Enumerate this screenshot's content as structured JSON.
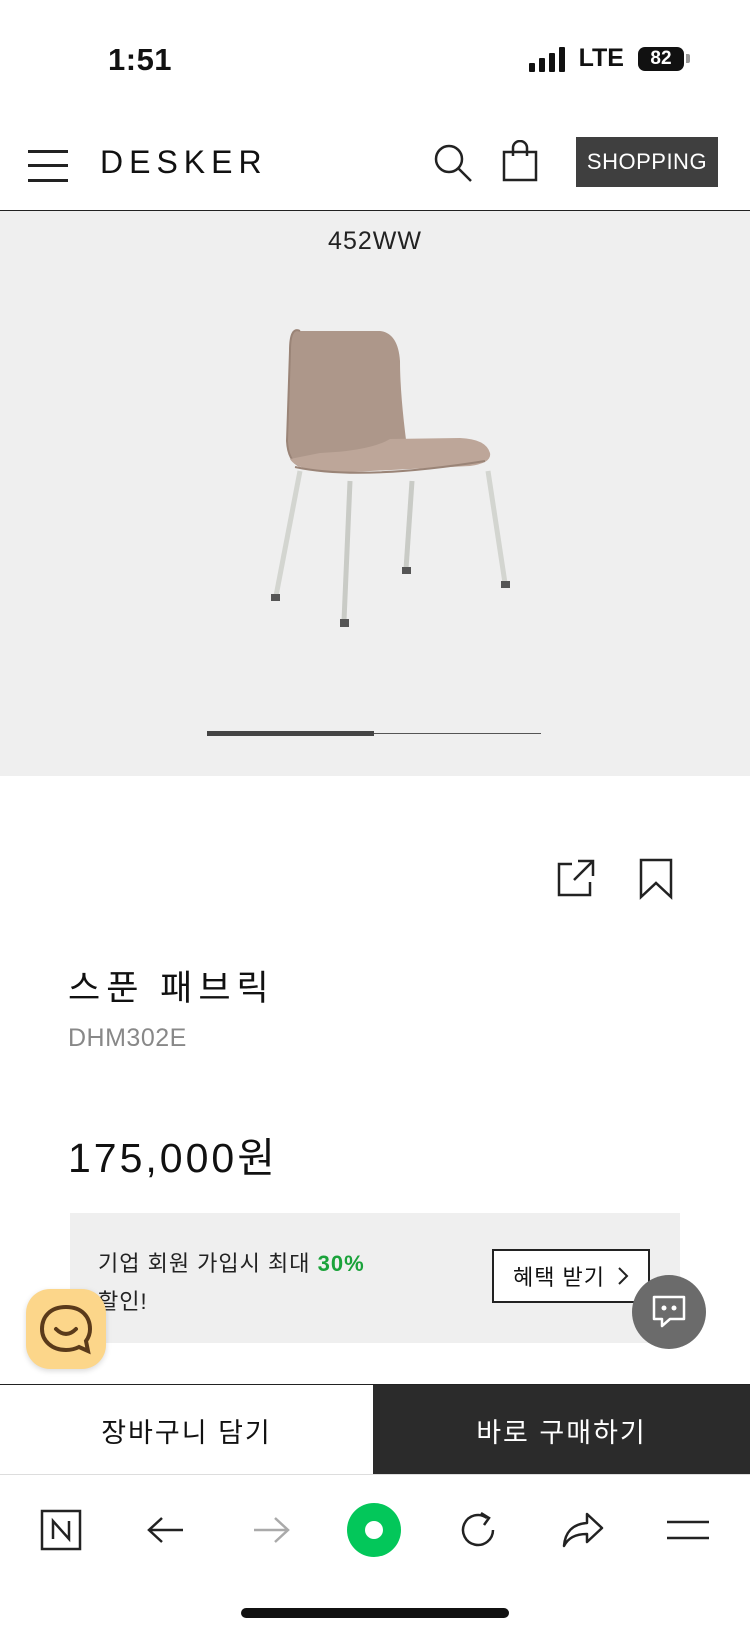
{
  "status_bar": {
    "time": "1:51",
    "network": "LTE",
    "battery": "82"
  },
  "header": {
    "brand": "DESKER",
    "shopping_button": "SHOPPING"
  },
  "hero": {
    "model_code": "452WW",
    "pager": {
      "current": 1,
      "total": 2
    }
  },
  "product": {
    "name": "스푼 패브릭",
    "code": "DHM302E",
    "price": "175,000원"
  },
  "benefit": {
    "text_before": "기업 회원 가입시 최대 ",
    "highlight": "30%",
    "text_after": "할인!",
    "button_label": "혜택 받기",
    "highlight_color": "#1aa23a"
  },
  "purchase_bar": {
    "cart_label": "장바구니 담기",
    "buy_label": "바로 구매하기"
  },
  "browser_toolbar": {
    "items": [
      "naver-home-icon",
      "back-arrow-icon",
      "forward-arrow-icon",
      "green-dot-icon",
      "refresh-icon",
      "share-arrow-icon",
      "menu-lines-icon"
    ],
    "accent_color": "#03c75a"
  }
}
